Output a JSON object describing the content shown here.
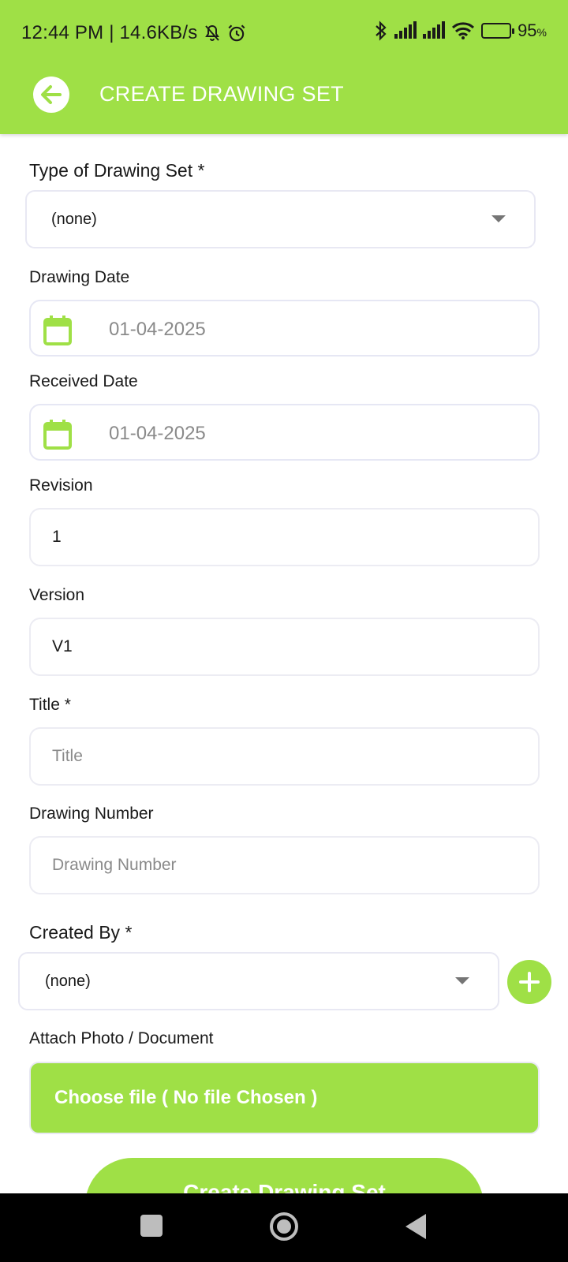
{
  "status_bar": {
    "time_speed": "12:44 PM | 14.6KB/s",
    "battery": "95"
  },
  "header": {
    "title": "CREATE DRAWING SET"
  },
  "form": {
    "type_label": "Type of Drawing Set *",
    "type_value": "(none)",
    "drawing_date_label": "Drawing Date",
    "drawing_date_value": "01-04-2025",
    "received_date_label": "Received Date",
    "received_date_value": "01-04-2025",
    "revision_label": "Revision",
    "revision_value": "1",
    "version_label": "Version",
    "version_value": "V1",
    "title_label": "Title *",
    "title_placeholder": "Title",
    "drawing_number_label": "Drawing Number",
    "drawing_number_placeholder": "Drawing Number",
    "created_by_label": "Created By *",
    "created_by_value": "(none)",
    "attach_label": "Attach Photo / Document",
    "choose_file_label": "Choose file ( No file Chosen )",
    "submit_label": "Create Drawing Set"
  },
  "colors": {
    "accent": "#9fe046",
    "navbar": "#000000"
  },
  "icons": {
    "back": "arrow-left-icon",
    "calendar": "calendar-icon",
    "add": "plus-icon",
    "dropdown": "caret-down-icon"
  }
}
